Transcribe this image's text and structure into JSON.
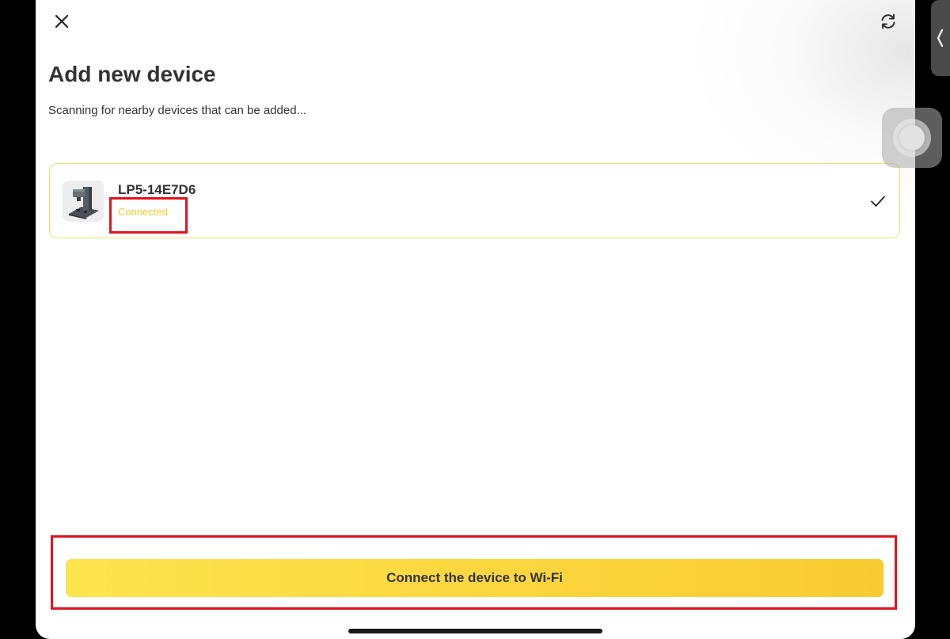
{
  "header": {
    "close_icon": "close-icon",
    "refresh_icon": "refresh-icon"
  },
  "page": {
    "title": "Add new device",
    "subtitle": "Scanning for nearby devices that can be added..."
  },
  "devices": [
    {
      "name": "LP5-14E7D6",
      "status": "Connected",
      "selected": true,
      "icon": "laser-engraver-device-image",
      "status_color": "#f2cc2b",
      "border_color": "#f2dd6b"
    }
  ],
  "actions": {
    "primary_label": "Connect the device to Wi-Fi",
    "primary_color": "#fbd63e"
  },
  "annotations": {
    "highlight_color": "#e0141e"
  }
}
